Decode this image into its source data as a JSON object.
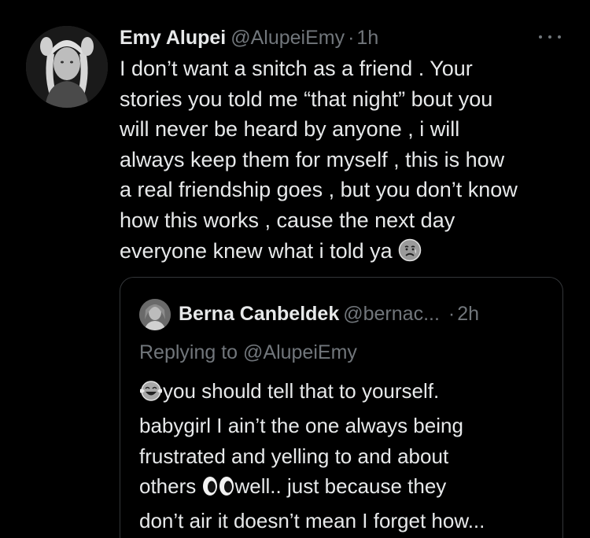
{
  "tweet": {
    "author_name": "Emy Alupei",
    "author_handle": "@AlupeiEmy",
    "separator": "·",
    "time": "1h",
    "avatar_icon": "profile-photo-avatar",
    "more_icon": "more-options-icon",
    "text_lines": [
      "I don’t want a snitch as a friend . Your",
      "stories you told me “that night” bout you",
      "will never be heard by anyone , i will",
      "always keep them for myself , this is how",
      "a real friendship goes , but you don’t know",
      "how this works , cause the next day",
      "everyone knew what i told ya"
    ],
    "trailing_emoji": "sad-but-relieved-face-emoji"
  },
  "quote": {
    "author_name": "Berna Canbeldek",
    "author_handle": "@bernac...",
    "separator": "·",
    "time": "2h",
    "avatar_icon": "profile-photo-avatar",
    "replying_to": "Replying to @AlupeiEmy",
    "leading_emoji": "face-with-tears-of-joy-emoji",
    "eyes_emoji": "eyes-emoji",
    "line1": "you should tell that to yourself.",
    "line2": "babygirl I ain’t the one always being",
    "line3": "frustrated and yelling to and about",
    "line4_before": "others ",
    "line4_after": "well.. just because they",
    "line5": "don’t air it doesn’t mean I forget how..."
  },
  "colors": {
    "background": "#000000",
    "primary_text": "#e7e9ea",
    "secondary_text": "#71767b",
    "border": "#333639"
  }
}
